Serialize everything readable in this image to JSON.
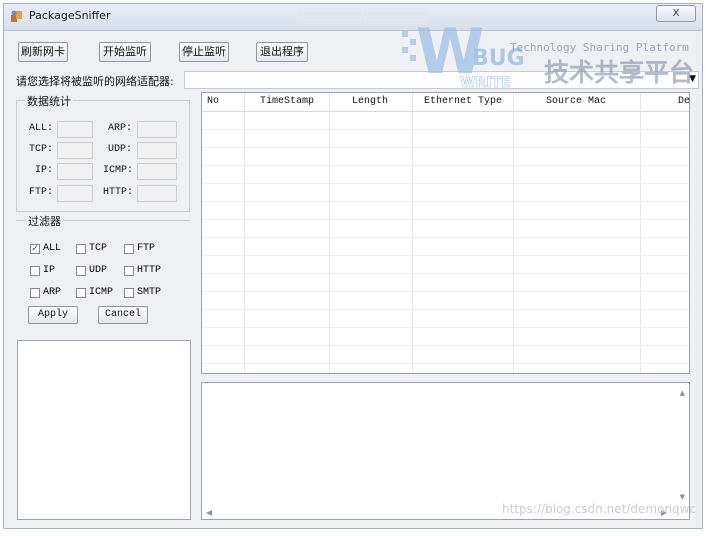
{
  "window": {
    "title": "PackageSniffer",
    "close_label": "X"
  },
  "toolbar": {
    "refresh_label": "刷新网卡",
    "start_label": "开始监听",
    "stop_label": "停止监听",
    "exit_label": "退出程序"
  },
  "adapter": {
    "label": "请您选择将被监听的网络适配器:",
    "value": ""
  },
  "stats": {
    "title": "数据统计",
    "items": [
      {
        "label": "ALL:",
        "value": ""
      },
      {
        "label": "ARP:",
        "value": ""
      },
      {
        "label": "TCP:",
        "value": ""
      },
      {
        "label": "UDP:",
        "value": ""
      },
      {
        "label": "IP:",
        "value": ""
      },
      {
        "label": "ICMP:",
        "value": ""
      },
      {
        "label": "FTP:",
        "value": ""
      },
      {
        "label": "HTTP:",
        "value": ""
      }
    ]
  },
  "filter": {
    "title": "过滤器",
    "options": [
      {
        "label": "ALL",
        "checked": true
      },
      {
        "label": "TCP",
        "checked": false
      },
      {
        "label": "FTP",
        "checked": false
      },
      {
        "label": "IP",
        "checked": false
      },
      {
        "label": "UDP",
        "checked": false
      },
      {
        "label": "HTTP",
        "checked": false
      },
      {
        "label": "ARP",
        "checked": false
      },
      {
        "label": "ICMP",
        "checked": false
      },
      {
        "label": "SMTP",
        "checked": false
      }
    ],
    "apply_label": "Apply",
    "cancel_label": "Cancel"
  },
  "packet_table": {
    "columns": [
      "No",
      "TimeStamp",
      "Length",
      "Ethernet Type",
      "Source Mac",
      "De"
    ]
  },
  "watermark": {
    "logo_w": "W",
    "logo_bug": "BUG",
    "logo_write": "WRITE",
    "tagline_en": "Technology Sharing Platform",
    "tagline_cn": "技术共享平台",
    "url": "https://blog.csdn.net/demonqwc"
  },
  "colors": {
    "accent": "#2a5fa8",
    "window_bg": "#eef0f4"
  }
}
